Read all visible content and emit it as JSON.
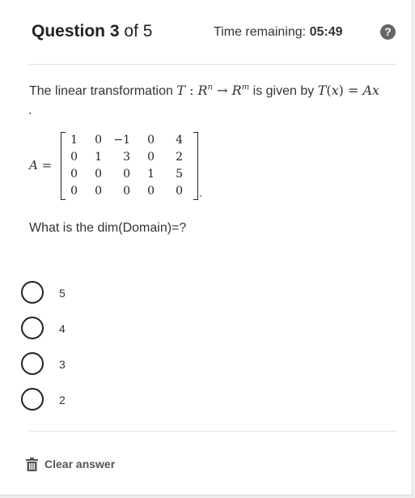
{
  "header": {
    "question_word": "Question",
    "question_number": "3",
    "of_text": "of 5",
    "timer_label": "Time remaining:",
    "timer_value": "05:49",
    "help_icon_glyph": "?"
  },
  "prompt": {
    "lead": "The linear transformation",
    "given_by": "is given by",
    "trailing_dot": "."
  },
  "matrix": {
    "name": "A",
    "rows": [
      [
        "1",
        "0",
        "−1",
        "0",
        "4"
      ],
      [
        "0",
        "1",
        "3",
        "0",
        "2"
      ],
      [
        "0",
        "0",
        "0",
        "1",
        "5"
      ],
      [
        "0",
        "0",
        "0",
        "0",
        "0"
      ]
    ]
  },
  "question": "What is the dim(Domain)=?",
  "options": [
    "5",
    "4",
    "3",
    "2"
  ],
  "footer": {
    "clear_label": "Clear answer",
    "clear_icon": "trash-icon"
  },
  "colors": {
    "radio_border": "#222222",
    "help_icon_bg": "#666666",
    "divider": "#e4e4e4"
  }
}
